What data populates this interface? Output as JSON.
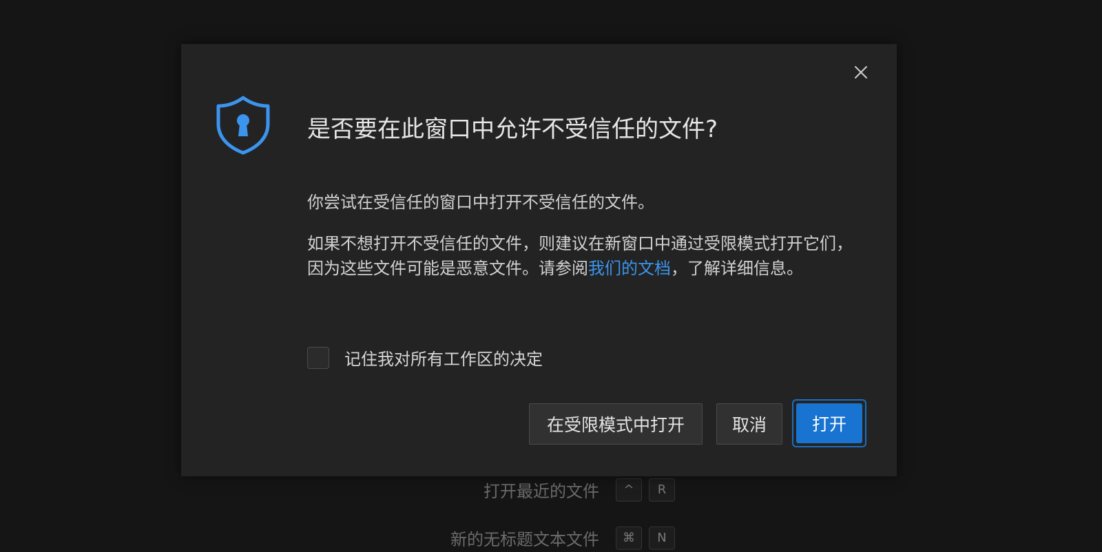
{
  "background": {
    "shortcuts": [
      {
        "label": "打开最近的文件",
        "keys": [
          "^",
          "R"
        ]
      },
      {
        "label": "新的无标题文本文件",
        "keys": [
          "⌘",
          "N"
        ]
      }
    ]
  },
  "dialog": {
    "title": "是否要在此窗口中允许不受信任的文件?",
    "icon": "shield-keyhole-icon",
    "close_icon": "close-icon",
    "message1": "你尝试在受信任的窗口中打开不受信任的文件。",
    "message2": {
      "before_link": "如果不想打开不受信任的文件，则建议在新窗口中通过受限模式打开它们，因为这些文件可能是恶意文件。请参阅",
      "link": "我们的文档",
      "after_link": "，了解详细信息。"
    },
    "checkbox": {
      "label": "记住我对所有工作区的决定",
      "checked": false
    },
    "buttons": {
      "restricted": "在受限模式中打开",
      "cancel": "取消",
      "open": "打开"
    }
  },
  "colors": {
    "accent": "#3b95ee",
    "primary_button": "#1874d0",
    "dialog_bg": "#232323",
    "page_bg": "#151515"
  }
}
